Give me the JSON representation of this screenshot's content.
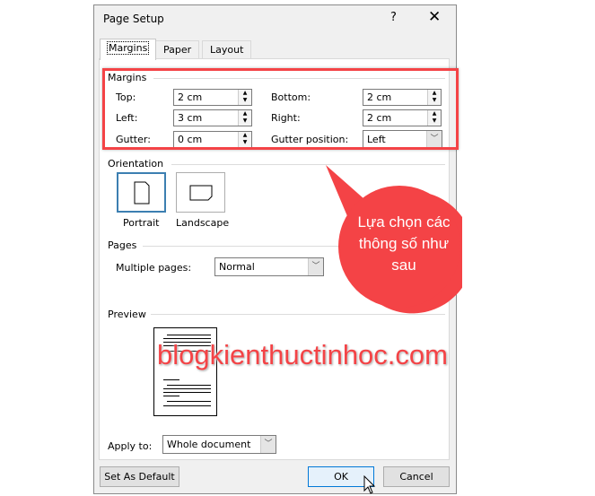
{
  "dialog": {
    "title": "Page Setup",
    "help": "?",
    "close": "✕"
  },
  "tabs": [
    {
      "label": "Margins"
    },
    {
      "label": "Paper"
    },
    {
      "label": "Layout"
    }
  ],
  "margins": {
    "group": "Margins",
    "top_label": "Top:",
    "top": "2 cm",
    "bottom_label": "Bottom:",
    "bottom": "2 cm",
    "left_label": "Left:",
    "left": "3 cm",
    "right_label": "Right:",
    "right": "2 cm",
    "gutter_label": "Gutter:",
    "gutter": "0 cm",
    "gutter_pos_label": "Gutter position:",
    "gutter_pos": "Left"
  },
  "orientation": {
    "group": "Orientation",
    "portrait": "Portrait",
    "landscape": "Landscape",
    "selected": "Portrait"
  },
  "pages": {
    "group": "Pages",
    "multiple_label": "Multiple pages:",
    "multiple": "Normal"
  },
  "preview": {
    "group": "Preview"
  },
  "apply": {
    "label": "Apply to:",
    "value": "Whole document"
  },
  "buttons": {
    "default": "Set As Default",
    "ok": "OK",
    "cancel": "Cancel"
  },
  "callout": {
    "text": "Lựa chọn các thông số như sau",
    "color": "#f44346"
  },
  "watermark": "blogkienthuctinhoc.com",
  "highlight_color": "#f44346"
}
